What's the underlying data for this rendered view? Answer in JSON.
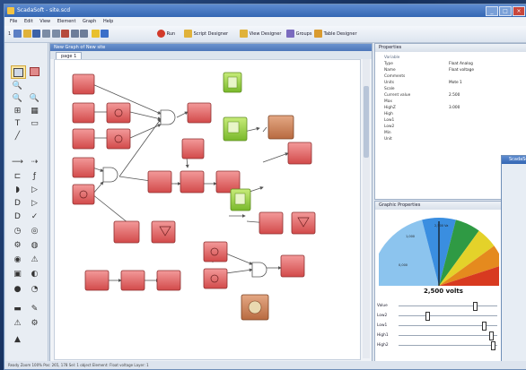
{
  "window": {
    "title": "ScadaSoft - site.scd"
  },
  "menu": [
    "File",
    "Edit",
    "View",
    "Element",
    "Graph",
    "Help"
  ],
  "toolbar": {
    "zoom": "1",
    "run_label": "Run",
    "script_designer_label": "Script Designer",
    "view_designer_label": "View Designer",
    "groups_label": "Groups",
    "table_designer_label": "Table Designer"
  },
  "document": {
    "title": "New Graph of New site",
    "tab": "page 1"
  },
  "properties": {
    "title": "Properties",
    "group": "Variable",
    "rows": [
      {
        "key": "Type",
        "value": "Float Analog"
      },
      {
        "key": "Name",
        "value": "Float voltage"
      },
      {
        "key": "Comments",
        "value": ""
      },
      {
        "key": "Units",
        "value": "Mote 1"
      },
      {
        "key": "Scale",
        "value": ""
      },
      {
        "key": "Current value",
        "value": "2.500"
      },
      {
        "key": "Max",
        "value": ""
      },
      {
        "key": "HighZ",
        "value": "3.000"
      },
      {
        "key": "High",
        "value": ""
      },
      {
        "key": "Low1",
        "value": ""
      },
      {
        "key": "Low2",
        "value": ""
      },
      {
        "key": "Min",
        "value": ""
      },
      {
        "key": "Unit",
        "value": ""
      }
    ]
  },
  "graphic": {
    "title": "Graphic Properties",
    "gauge_value": "2,500 volts",
    "gauge_max": 5000,
    "gauge_current": 2500,
    "zone_colors": [
      "#8cc4ee",
      "#3a8ee0",
      "#2f9a44",
      "#e4d22a",
      "#e58a1e",
      "#d83a20"
    ],
    "ticks": [
      "2,500 Va",
      "1,000",
      "0,000"
    ],
    "sliders": [
      {
        "label": "Value",
        "pos": 0.78
      },
      {
        "label": "Low2",
        "pos": 0.28
      },
      {
        "label": "Low1",
        "pos": 0.88
      },
      {
        "label": "High1",
        "pos": 0.95
      },
      {
        "label": "High2",
        "pos": 0.97
      }
    ]
  },
  "popup": {
    "title": "ScadaSoft"
  },
  "status": "Ready  Zoom 100%  Pos: 265, 178  Sel: 1 object  Element: Float voltage  Layer: 1"
}
